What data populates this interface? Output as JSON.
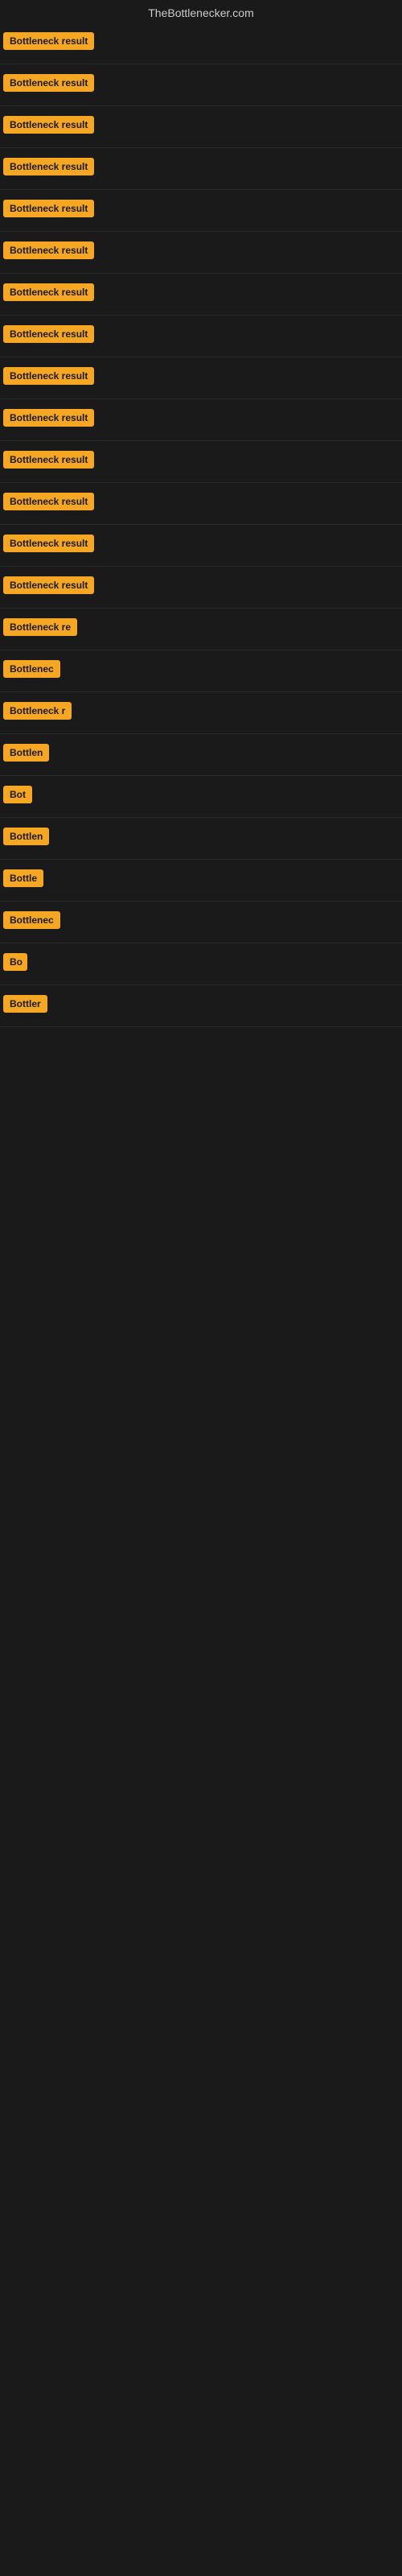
{
  "site": {
    "title": "TheBottlenecker.com"
  },
  "results": [
    {
      "id": 1,
      "label": "Bottleneck result",
      "width": 130
    },
    {
      "id": 2,
      "label": "Bottleneck result",
      "width": 130
    },
    {
      "id": 3,
      "label": "Bottleneck result",
      "width": 130
    },
    {
      "id": 4,
      "label": "Bottleneck result",
      "width": 130
    },
    {
      "id": 5,
      "label": "Bottleneck result",
      "width": 130
    },
    {
      "id": 6,
      "label": "Bottleneck result",
      "width": 130
    },
    {
      "id": 7,
      "label": "Bottleneck result",
      "width": 130
    },
    {
      "id": 8,
      "label": "Bottleneck result",
      "width": 130
    },
    {
      "id": 9,
      "label": "Bottleneck result",
      "width": 130
    },
    {
      "id": 10,
      "label": "Bottleneck result",
      "width": 130
    },
    {
      "id": 11,
      "label": "Bottleneck result",
      "width": 130
    },
    {
      "id": 12,
      "label": "Bottleneck result",
      "width": 130
    },
    {
      "id": 13,
      "label": "Bottleneck result",
      "width": 130
    },
    {
      "id": 14,
      "label": "Bottleneck result",
      "width": 130
    },
    {
      "id": 15,
      "label": "Bottleneck re",
      "width": 105
    },
    {
      "id": 16,
      "label": "Bottlenec",
      "width": 80
    },
    {
      "id": 17,
      "label": "Bottleneck r",
      "width": 92
    },
    {
      "id": 18,
      "label": "Bottlen",
      "width": 68
    },
    {
      "id": 19,
      "label": "Bot",
      "width": 40
    },
    {
      "id": 20,
      "label": "Bottlen",
      "width": 68
    },
    {
      "id": 21,
      "label": "Bottle",
      "width": 58
    },
    {
      "id": 22,
      "label": "Bottlenec",
      "width": 78
    },
    {
      "id": 23,
      "label": "Bo",
      "width": 30
    },
    {
      "id": 24,
      "label": "Bottler",
      "width": 60
    }
  ]
}
